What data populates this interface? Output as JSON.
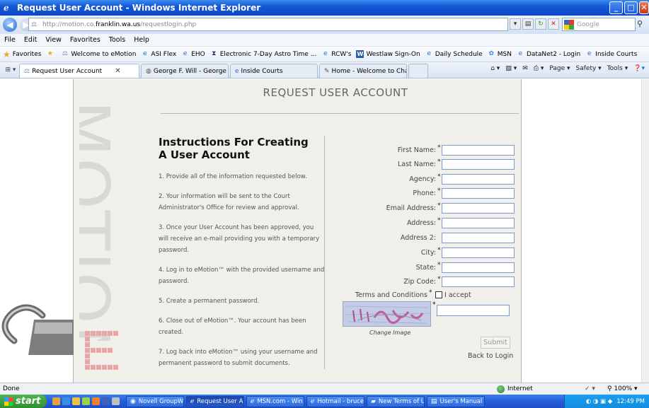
{
  "window": {
    "title": "Request User Account - Windows Internet Explorer"
  },
  "address_bar": {
    "url_prefix": "http://motion.co.",
    "url_domain": "franklin.wa.us",
    "url_path": "/requestlogin.php",
    "search_placeholder": "Google"
  },
  "menu": {
    "items": [
      "File",
      "Edit",
      "View",
      "Favorites",
      "Tools",
      "Help"
    ]
  },
  "favorites": {
    "label": "Favorites",
    "links": [
      "Welcome to eMotion",
      "ASI Flex",
      "EHO",
      "Electronic 7-Day Astro Time ...",
      "RCW's",
      "Westlaw Sign-On",
      "Daily Schedule",
      "MSN",
      "DataNet2 - Login",
      "Inside Courts"
    ]
  },
  "tabs": {
    "items": [
      "Request User Account",
      "George F. Will - George F. Wi...",
      "Inside Courts",
      "Home - Welcome to Charter...."
    ],
    "tools": [
      "Page ▾",
      "Safety ▾",
      "Tools ▾"
    ]
  },
  "page": {
    "title": "REQUEST USER ACCOUNT",
    "brand_word": "MOTION",
    "instructions_title": "Instructions For Creating A User Account",
    "steps": [
      "1. Provide all of the information requested below.",
      "2. Your information will be sent to the Court Administrator's Office for review and approval.",
      "3. Once your User Account has been approved, you will receive an e-mail providing you with a temporary password.",
      "4. Log in to eMotion™ with the provided username and password.",
      "5. Create a permanent password.",
      "6. Close out of eMotion™. Your account has been created.",
      "7. Log back into eMotion™ using your username and permanent password to submit documents."
    ],
    "form": {
      "fields": [
        {
          "label": "First Name:",
          "required": "*"
        },
        {
          "label": "Last Name:",
          "required": "*"
        },
        {
          "label": "Agency:",
          "required": "*"
        },
        {
          "label": "Phone:",
          "required": "*"
        },
        {
          "label": "Email Address:",
          "required": "*"
        },
        {
          "label": "Address:",
          "required": "*"
        },
        {
          "label": "Address 2:",
          "required": ""
        },
        {
          "label": "City:",
          "required": "*"
        },
        {
          "label": "State:",
          "required": "*"
        },
        {
          "label": "Zip Code:",
          "required": "*"
        }
      ],
      "terms_label": "Terms and Conditions",
      "terms_required": "*",
      "accept_label": "I accept",
      "captcha_required": "*",
      "change_image": "Change Image",
      "submit": "Submit",
      "back_to_login": "Back to Login"
    }
  },
  "status": {
    "text": "Done",
    "zone": "Internet",
    "zoom": "100%"
  },
  "taskbar": {
    "start": "start",
    "tasks": [
      "Novell GroupWi...",
      "Request User A...",
      "MSN.com - Win...",
      "Hotmail - bruces...",
      "New Terms of U...",
      "User's Manual (J..."
    ],
    "clock": "12:49 PM"
  }
}
